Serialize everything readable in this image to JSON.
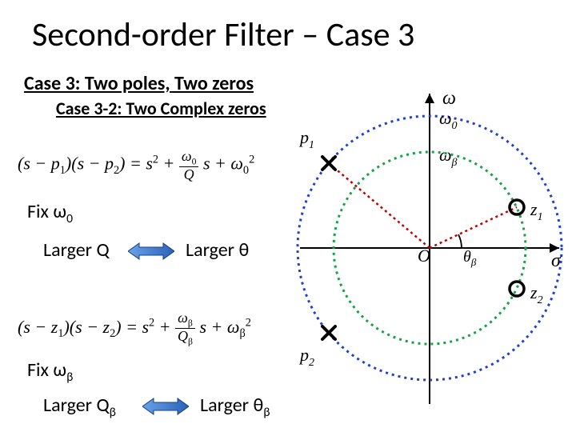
{
  "title": "Second-order Filter – Case 3",
  "subtitle1": "Case 3: Two poles, Two zeros",
  "subtitle2": "Case 3-2: Two Complex zeros",
  "formula1_html": "(<i>s</i> − <i>p</i><sub>1</sub>)(<i>s</i> − <i>p</i><sub>2</sub>) = <i>s</i><sup>2</sup> + <span class='frac'><span class='top'><i>ω</i><sub>0</sub></span><span class='bot'><i>Q</i></span></span> <i>s</i> + <i>ω</i><sub>0</sub><sup>2</sup>",
  "formula2_html": "(<i>s</i> − <i>z</i><sub>1</sub>)(<i>s</i> − <i>z</i><sub>2</sub>) = <i>s</i><sup>2</sup> + <span class='frac'><span class='top'><i>ω</i><sub>β</sub></span><span class='bot'><i>Q</i><sub>β</sub></span></span> <i>s</i> + <i>ω</i><sub>β</sub><sup>2</sup>",
  "fix1": "Fix ω",
  "fix1_sub": "0",
  "largerQ1": "Larger Q",
  "largerT1": "Larger θ",
  "fix2": "Fix ω",
  "fix2_sub": "β",
  "largerQ2": "Larger Q",
  "largerQ2_sub": "β",
  "largerT2": "Larger θ",
  "largerT2_sub": "β",
  "diagram": {
    "x_axis": "σ",
    "y_axis": "ω",
    "origin": "O",
    "omega0": "ω₀",
    "omegabeta": "ω_β",
    "p1": "p₁",
    "p2": "p₂",
    "z1": "z₁",
    "z2": "z₂",
    "theta_beta": "θ_β",
    "colors": {
      "outer_circle": "#1f3fd1",
      "inner_circle": "#1aa04a",
      "radii": "#c00000"
    }
  },
  "chart_data": {
    "type": "diagram",
    "description": "Pole-zero plot on s-plane with two dotted circles centered at origin.",
    "axes": {
      "x": "σ (real)",
      "y": "ω (imaginary)"
    },
    "circles": [
      {
        "name": "poles circle",
        "radius_label": "ω₀",
        "style": "dotted blue"
      },
      {
        "name": "zeros circle",
        "radius_label": "ω_β",
        "style": "dotted green",
        "note": "smaller than ω₀ circle"
      }
    ],
    "points": [
      {
        "name": "p₁",
        "type": "pole",
        "quadrant": "upper-left",
        "on_circle": "ω₀"
      },
      {
        "name": "p₂",
        "type": "pole",
        "quadrant": "lower-left",
        "on_circle": "ω₀",
        "note": "conjugate of p₁"
      },
      {
        "name": "z₁",
        "type": "zero",
        "quadrant": "upper-right",
        "on_circle": "ω_β"
      },
      {
        "name": "z₂",
        "type": "zero",
        "quadrant": "lower-right",
        "on_circle": "ω_β",
        "note": "conjugate of z₁"
      }
    ],
    "segments": [
      {
        "from": "O",
        "to": "p₁",
        "style": "dotted red"
      },
      {
        "from": "O",
        "to": "z₁",
        "style": "dotted red"
      }
    ],
    "angle": {
      "label": "θ_β",
      "between": "positive σ-axis and line to z₁"
    }
  }
}
